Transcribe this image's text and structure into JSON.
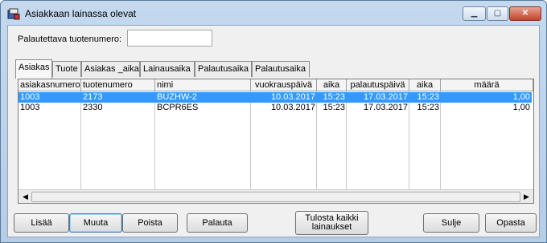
{
  "window": {
    "title": "Asiakkaan lainassa olevat",
    "controls": {
      "minimize": "▁",
      "maximize": "▢",
      "close": "✕"
    }
  },
  "search": {
    "label": "Palautettava tuotenumero:",
    "value": "",
    "placeholder": ""
  },
  "tabs": [
    {
      "label": "Asiakas",
      "active": true
    },
    {
      "label": "Tuote"
    },
    {
      "label": "Asiakas _aika"
    },
    {
      "label": "Lainausaika"
    },
    {
      "label": "Palautusaika"
    },
    {
      "label": "Palautusaika"
    }
  ],
  "table": {
    "columns": [
      "asiakasnumero",
      "tuotenumero",
      "nimi",
      "vuokrauspäivä",
      "aika",
      "palautuspäivä",
      "aika",
      "määrä"
    ],
    "rows": [
      [
        "1003",
        "2173",
        "BUZHW-2",
        "10.03.2017",
        "15:23",
        "17.03.2017",
        "15:23",
        "1,00"
      ],
      [
        "1003",
        "2330",
        "BCPR6ES",
        "10.03.2017",
        "15:23",
        "17.03.2017",
        "15:23",
        "1,00"
      ]
    ],
    "selected_row": 0,
    "scroll": {
      "left_arrow": "◀",
      "right_arrow": "▶"
    }
  },
  "buttons": {
    "lisaa": "Lisää",
    "muuta": "Muuta",
    "poista": "Poista",
    "palauta": "Palauta",
    "tulosta_line1": "Tulosta kaikki",
    "tulosta_line2": "lainaukset",
    "sulje": "Sulje",
    "opasta": "Opasta"
  },
  "colors": {
    "selection": "#3399ff",
    "title_bar": "#c4d9ee",
    "close_button": "#c7412c"
  },
  "icons": {
    "app": "app-window-icon",
    "minimize": "minimize-icon",
    "maximize": "maximize-icon",
    "close": "close-icon"
  }
}
